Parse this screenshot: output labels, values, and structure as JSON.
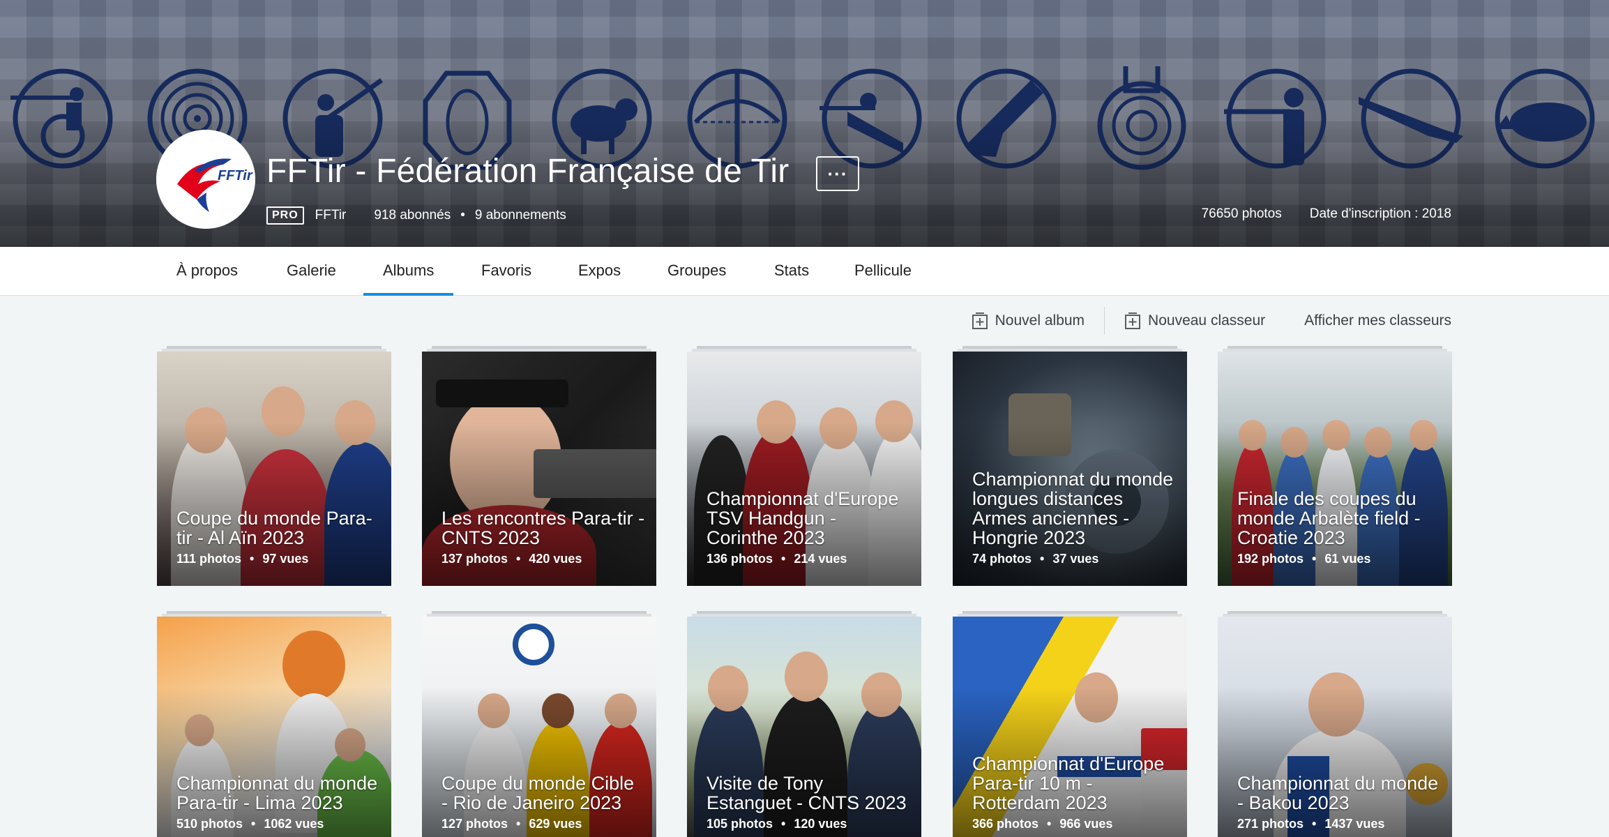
{
  "profile": {
    "name": "FFTir - Fédération Française de Tir",
    "more_label": "···",
    "pro_badge": "PRO",
    "username": "FFTir",
    "followers": "918 abonnés",
    "following": "9 abonnements",
    "separator": "•",
    "photos": "76650 photos",
    "joined": "Date d'inscription : 2018",
    "avatar_logo_text": "FFTir"
  },
  "tabs": [
    {
      "label": "À propos",
      "active": false
    },
    {
      "label": "Galerie",
      "active": false
    },
    {
      "label": "Albums",
      "active": true
    },
    {
      "label": "Favoris",
      "active": false
    },
    {
      "label": "Expos",
      "active": false
    },
    {
      "label": "Groupes",
      "active": false
    },
    {
      "label": "Stats",
      "active": false
    },
    {
      "label": "Pellicule",
      "active": false
    }
  ],
  "actions": {
    "new_album": "Nouvel album",
    "new_binder": "Nouveau classeur",
    "show_binders": "Afficher mes classeurs"
  },
  "albums": [
    {
      "title": "Coupe du monde Para-tir - Al Aïn 2023",
      "photos": "111 photos",
      "views": "97 vues"
    },
    {
      "title": "Les rencontres Para-tir - CNTS 2023",
      "photos": "137 photos",
      "views": "420 vues"
    },
    {
      "title": "Championnat d'Europe TSV Handgun - Corinthe 2023",
      "photos": "136 photos",
      "views": "214 vues"
    },
    {
      "title": "Championnat du monde longues distances Armes anciennes - Hongrie 2023",
      "photos": "74 photos",
      "views": "37 vues"
    },
    {
      "title": "Finale des coupes du monde Arbalète field - Croatie 2023",
      "photos": "192 photos",
      "views": "61 vues"
    },
    {
      "title": "Championnat du monde Para-tir - Lima 2023",
      "photos": "510 photos",
      "views": "1062 vues"
    },
    {
      "title": "Coupe du monde Cible - Rio de Janeiro 2023",
      "photos": "127 photos",
      "views": "629 vues"
    },
    {
      "title": "Visite de Tony Estanguet - CNTS 2023",
      "photos": "105 photos",
      "views": "120 vues"
    },
    {
      "title": "Championnat d'Europe Para-tir 10 m - Rotterdam 2023",
      "photos": "366 photos",
      "views": "966 vues"
    },
    {
      "title": "Championnat du monde - Bakou 2023",
      "photos": "271 photos",
      "views": "1437 vues"
    }
  ],
  "colors": {
    "accent": "#128fdc",
    "icon_blue": "#162a5c"
  }
}
